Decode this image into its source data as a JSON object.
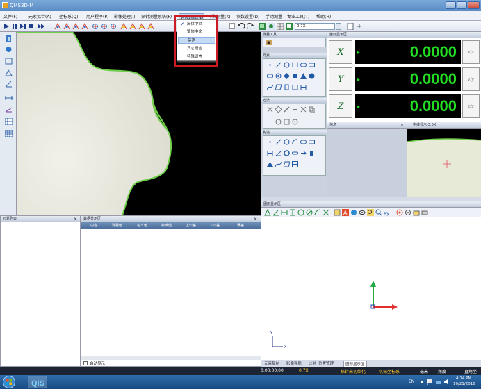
{
  "window": {
    "title": "QMS3D-M"
  },
  "menu": [
    "文件(F)",
    "元素拟合(A)",
    "坐标系(Q)",
    "用户程序(P)",
    "影像处理(I)",
    "探针测量系统(F)",
    "语言选择(N)",
    "特殊测量(K)",
    "参数设置(D)",
    "手动测量",
    "专业工具(T)",
    "帮助(H)"
  ],
  "toolbar": {
    "zoom_label": "0.7X"
  },
  "language_menu": {
    "items": [
      {
        "label": "简体中文",
        "checked": true,
        "highlighted": false
      },
      {
        "label": "繁体中文",
        "checked": false,
        "highlighted": false
      },
      {
        "label": "英语",
        "checked": false,
        "highlighted": true
      },
      {
        "label": "其它语言",
        "checked": false,
        "highlighted": false
      },
      {
        "label": "特殊语言",
        "checked": false,
        "highlighted": false
      }
    ]
  },
  "palette": {
    "measure_tools": "测量工具",
    "elements": "元素",
    "methods": "方法",
    "construct": "构造"
  },
  "coords": {
    "panel_title": "坐标显示区",
    "rows": [
      {
        "axis": "X",
        "value": "0.0000",
        "unit": "x/x"
      },
      {
        "axis": "Y",
        "value": "0.0000",
        "unit": "y/y"
      },
      {
        "axis": "Z",
        "value": "0.0000",
        "unit": "z/z"
      }
    ]
  },
  "msgpanel": {
    "title": "信息"
  },
  "crosspanel": {
    "title": "十字线显示-3.0X"
  },
  "graphpanel": {
    "title": "图形显示区"
  },
  "featurelist": {
    "title": "元素列表"
  },
  "datapanel": {
    "title": "数据显示区",
    "columns": [
      "内容",
      "测量值",
      "名义值",
      "标准值",
      "上公差",
      "下公差",
      "误差"
    ],
    "auto_show": "自动显示"
  },
  "bottom_tabs": [
    "元素复制",
    "影像导航",
    "比对",
    "位置管理",
    "图形显示区"
  ],
  "status": {
    "time": "0:00:00:00",
    "zoom": "0.7X",
    "probe": "探针未初始化",
    "coord_system": "机械坐标系",
    "unit": "毫米",
    "angle": "角度",
    "length": "直角坐"
  },
  "taskbar": {
    "lang": "EN",
    "time": "4:14 PM",
    "date": "10/21/2016"
  },
  "colors": {
    "accent_red": "#cc1b22",
    "lcd_green": "#22dd22",
    "axis_green": "#1a6b2a"
  }
}
